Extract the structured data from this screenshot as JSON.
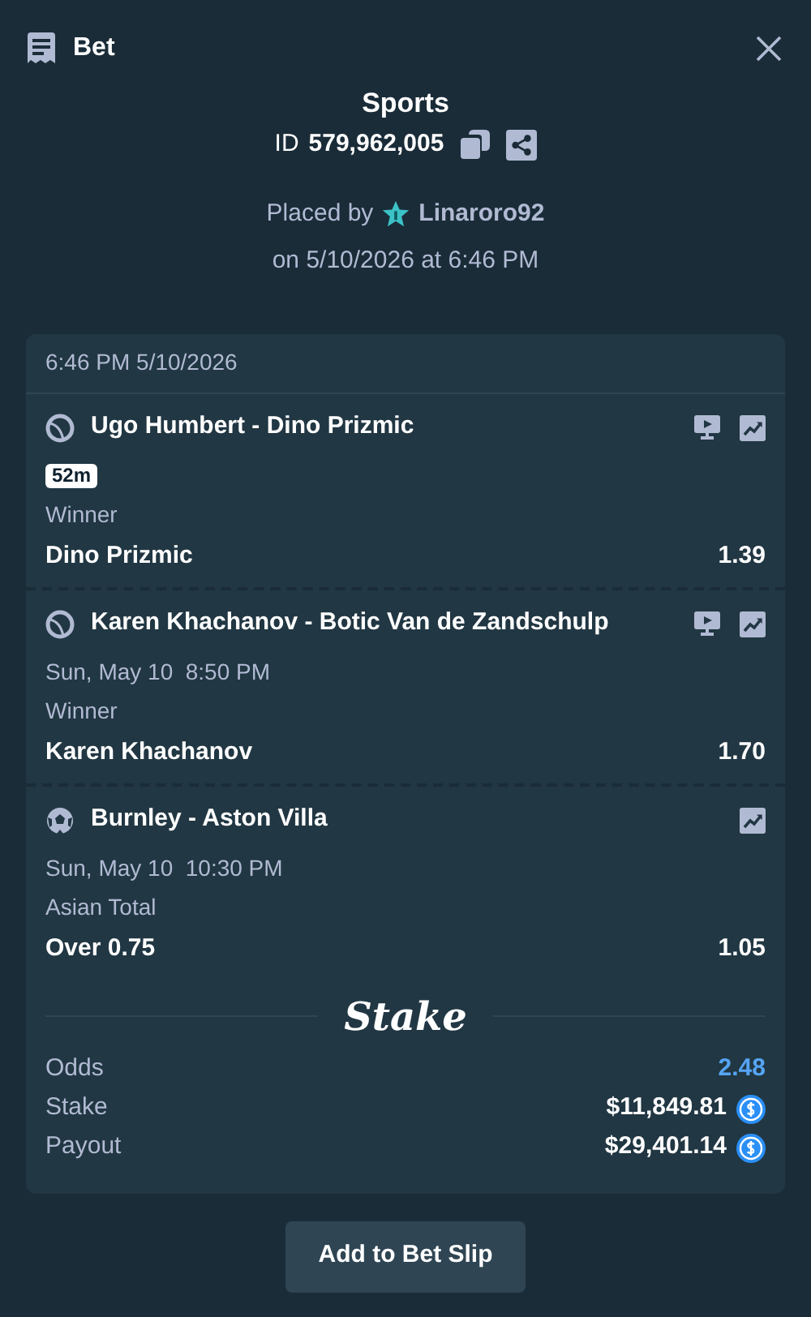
{
  "header": {
    "title": "Bet"
  },
  "bet": {
    "category": "Sports",
    "id_label": "ID",
    "id": "579,962,005",
    "placed_by_label": "Placed by",
    "user": "Linaroro92",
    "placed_on": "on 5/10/2026 at 6:46 PM"
  },
  "slip": {
    "timestamp": "6:46 PM 5/10/2026",
    "legs": [
      {
        "kind": "tennis",
        "event": "Ugo Humbert - Dino Prizmic",
        "stream": true,
        "live_badge": "52m",
        "market": "Winner",
        "selection": "Dino Prizmic",
        "odds": "1.39"
      },
      {
        "kind": "tennis",
        "event": "Karen Khachanov - Botic Van de Zandschulp",
        "stream": true,
        "start": "Sun, May 10  8:50 PM",
        "market": "Winner",
        "selection": "Karen Khachanov",
        "odds": "1.70"
      },
      {
        "kind": "soccer",
        "event": "Burnley - Aston Villa",
        "stream": false,
        "start": "Sun, May 10  10:30 PM",
        "market": "Asian Total",
        "selection": "Over 0.75",
        "odds": "1.05"
      }
    ],
    "logo": "Stake",
    "summary": [
      {
        "label": "Odds",
        "value": "2.48",
        "kind": "odds"
      },
      {
        "label": "Stake",
        "value": "$11,849.81",
        "kind": "amount"
      },
      {
        "label": "Payout",
        "value": "$29,401.14",
        "kind": "amount"
      }
    ]
  },
  "button": "Add to Bet Slip"
}
